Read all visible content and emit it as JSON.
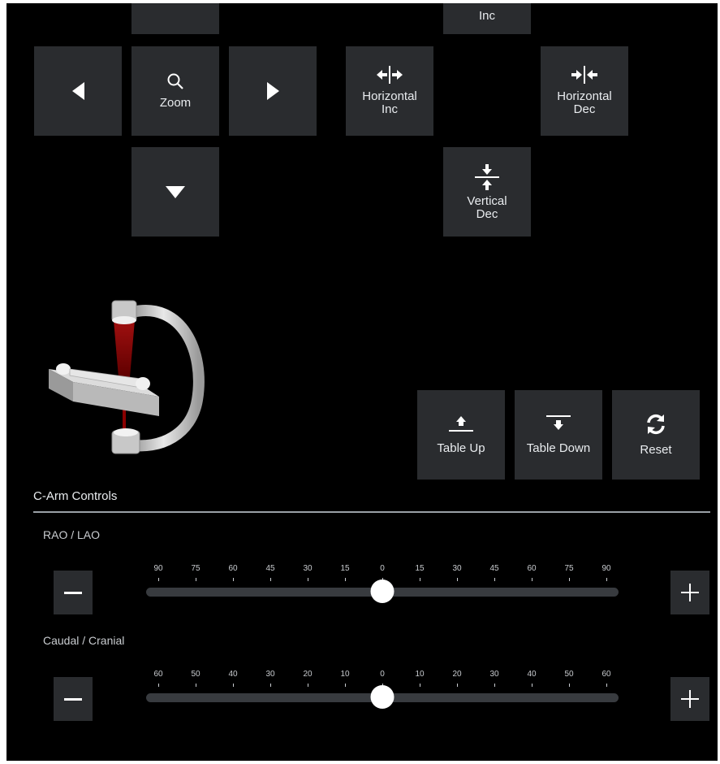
{
  "pan_controls": {
    "zoom_label": "Zoom"
  },
  "collimator": {
    "vertical_inc_label": "Inc",
    "horizontal_inc_label": "Horizontal Inc",
    "horizontal_dec_label": "Horizontal Dec",
    "vertical_dec_label": "Vertical Dec"
  },
  "table_controls": {
    "table_up_label": "Table Up",
    "table_down_label": "Table Down",
    "reset_label": "Reset"
  },
  "carm": {
    "section_title": "C-Arm Controls",
    "rao_lao": {
      "label": "RAO / LAO",
      "ticks": [
        "90",
        "75",
        "60",
        "45",
        "30",
        "15",
        "0",
        "15",
        "30",
        "45",
        "60",
        "75",
        "90"
      ],
      "value": 0
    },
    "caudal_cranial": {
      "label": "Caudal / Cranial",
      "ticks": [
        "60",
        "50",
        "40",
        "30",
        "20",
        "10",
        "0",
        "10",
        "20",
        "30",
        "40",
        "50",
        "60"
      ],
      "value": 0
    }
  },
  "colors": {
    "background": "#000000",
    "button_bg": "#2a2c2f",
    "beam": "#8b0000",
    "track": "#383b3f"
  }
}
